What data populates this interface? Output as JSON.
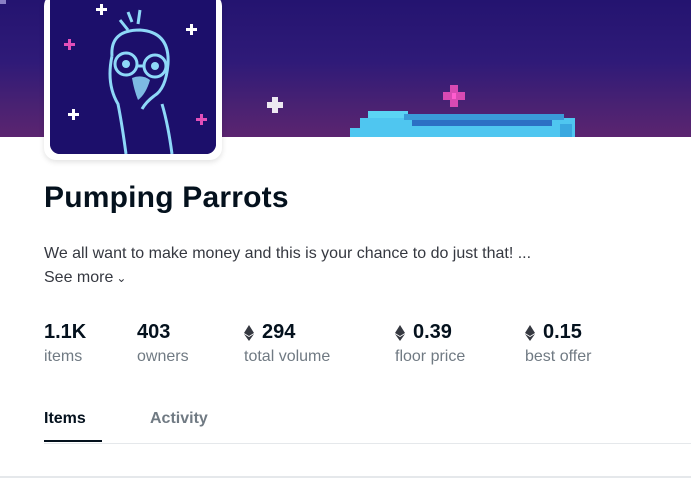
{
  "collection": {
    "name": "Pumping Parrots",
    "description": "We all want to make money and this is your chance to do just that!  ...",
    "see_more_label": "See more",
    "see_more_icon": "chevron-down-icon"
  },
  "stats": [
    {
      "value": "1.1K",
      "label": "items",
      "currency_icon": false
    },
    {
      "value": "403",
      "label": "owners",
      "currency_icon": false
    },
    {
      "value": "294",
      "label": "total volume",
      "currency_icon": true
    },
    {
      "value": "0.39",
      "label": "floor price",
      "currency_icon": true
    },
    {
      "value": "0.15",
      "label": "best offer",
      "currency_icon": true
    }
  ],
  "tabs": [
    {
      "label": "Items",
      "active": true
    },
    {
      "label": "Activity",
      "active": false
    }
  ],
  "colors": {
    "text_primary": "#04111d",
    "text_secondary": "#707a83",
    "banner": "#2f1a78",
    "parrot": "#8ed8f8"
  }
}
